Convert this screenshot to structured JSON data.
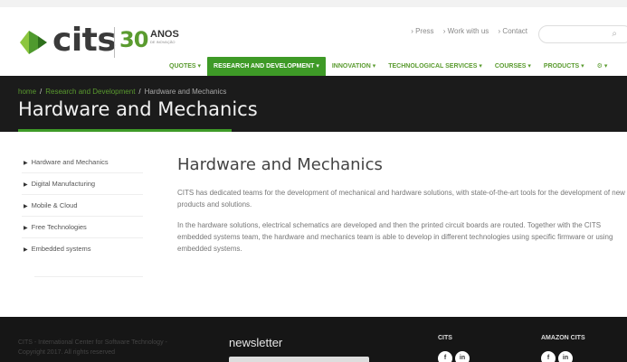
{
  "header": {
    "logo_text": "cits",
    "badge_number": "30",
    "badge_word": "ANOS",
    "badge_sub": "DE INOVAÇÃO",
    "top_links": [
      "› Press",
      "› Work with us",
      "› Contact"
    ],
    "search_placeholder": "",
    "nav": [
      {
        "label": "QUOTES ▾",
        "active": false
      },
      {
        "label": "RESEARCH AND DEVELOPMENT ▾",
        "active": true
      },
      {
        "label": "INNOVATION ▾",
        "active": false
      },
      {
        "label": "TECHNOLOGICAL SERVICES ▾",
        "active": false
      },
      {
        "label": "COURSES ▾",
        "active": false
      },
      {
        "label": "PRODUCTS ▾",
        "active": false
      },
      {
        "label": "⚙ ▾",
        "active": false
      }
    ]
  },
  "breadcrumb": {
    "home": "home",
    "section": "Research and Development",
    "current": "Hardware and Mechanics"
  },
  "page_title": "Hardware and Mechanics",
  "sidebar": {
    "items": [
      "Hardware and Mechanics",
      "Digital Manufacturing",
      "Mobile & Cloud",
      "Free Technologies",
      "Embedded systems"
    ]
  },
  "main": {
    "heading": "Hardware and Mechanics",
    "paragraphs": [
      "CITS has dedicated teams for the development of mechanical and hardware solutions, with state-of-the-art tools for the development of new products and solutions.",
      "In the hardware solutions, electrical schematics are developed and then the printed circuit boards are routed. Together with the CITS embedded systems team, the hardware and mechanics team is able to develop in different technologies using specific firmware or using embedded systems."
    ]
  },
  "footer": {
    "copyright_1": "CITS - International Center for Software Technology -",
    "copyright_2": "Copyright 2017. All rights reserved",
    "newsletter_title": "newsletter",
    "col_cits": "CITS",
    "col_amazon": "AMAZON CITS",
    "social_f": "f",
    "social_in": "in"
  }
}
